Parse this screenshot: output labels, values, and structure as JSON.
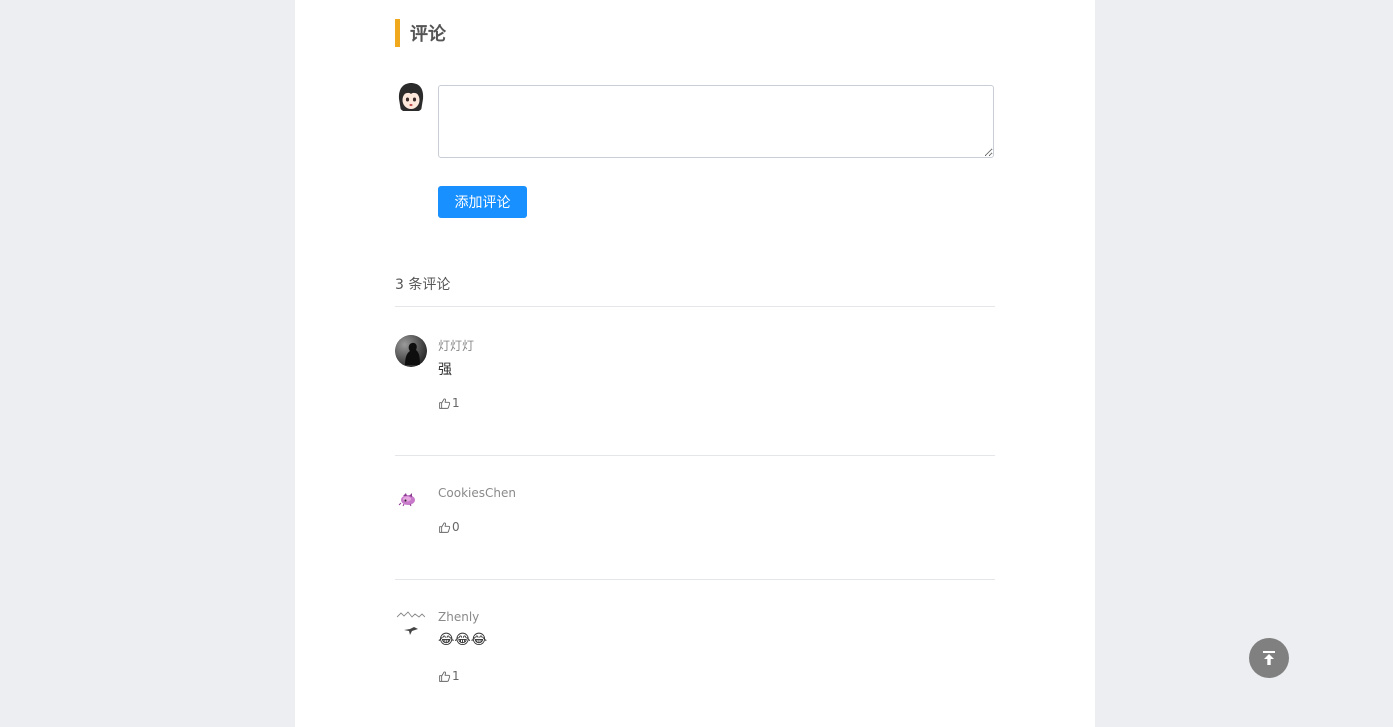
{
  "section": {
    "title": "评论"
  },
  "composer": {
    "placeholder": "",
    "submit_label": "添加评论"
  },
  "comments_count_label": "3 条评论",
  "comments": [
    {
      "author": "灯灯灯",
      "body": "强",
      "likes": "1"
    },
    {
      "author": "CookiesChen",
      "body": "",
      "likes": "0"
    },
    {
      "author": "Zhenly",
      "body": "😂😂😂",
      "likes": "1"
    }
  ],
  "colors": {
    "accent_bar": "#f0a81c",
    "primary_button": "#1890ff",
    "page_bg": "#edeef2"
  },
  "icons": {
    "like": "thumbs-up-icon",
    "back_to_top": "arrow-up-to-line-icon"
  }
}
